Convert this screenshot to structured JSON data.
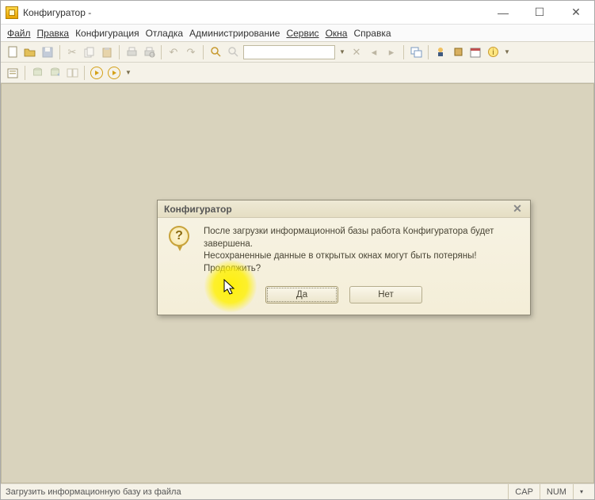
{
  "title": "Конфигуратор -",
  "menu": {
    "file": "Файл",
    "edit": "Правка",
    "config": "Конфигурация",
    "debug": "Отладка",
    "admin": "Администрирование",
    "service": "Сервис",
    "windows": "Окна",
    "help": "Справка"
  },
  "window_controls": {
    "min": "—",
    "max": "☐",
    "close": "✕"
  },
  "dialog": {
    "title": "Конфигуратор",
    "line1": "После загрузки информационной базы работа Конфигуратора будет завершена.",
    "line2": "Несохраненные данные в открытых окнах могут быть потеряны!",
    "line3": "Продолжить?",
    "yes": "Да",
    "no": "Нет",
    "close": "✕",
    "icon_glyph": "?"
  },
  "status": {
    "left": "Загрузить информационную базу из файла",
    "cap": "CAP",
    "num": "NUM"
  },
  "toolbar_search_placeholder": ""
}
